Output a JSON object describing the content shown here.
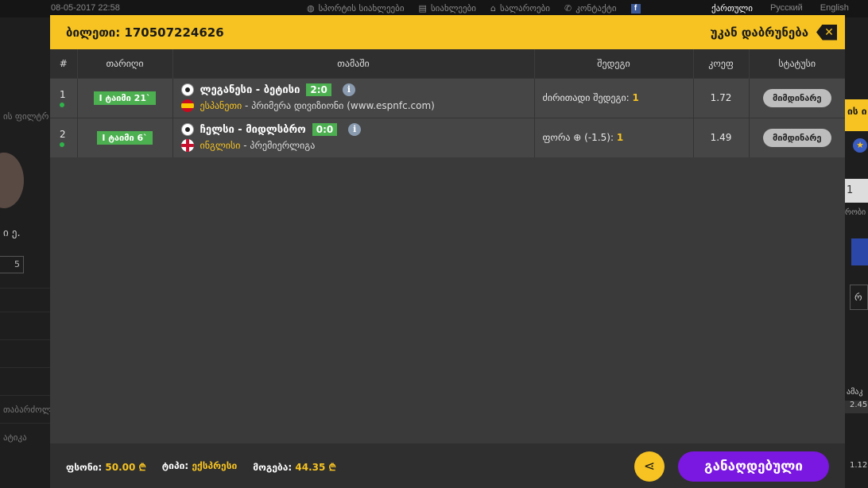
{
  "topbar": {
    "datetime": "08-05-2017 22:58",
    "nav": [
      {
        "label": "სპორტის სიახლეები",
        "icon": "globe-icon"
      },
      {
        "label": "სიახლეები",
        "icon": "newspaper-icon"
      },
      {
        "label": "სალაროები",
        "icon": "home-icon"
      },
      {
        "label": "კონტაქტი",
        "icon": "phone-icon"
      },
      {
        "label": "",
        "icon": "facebook-icon"
      }
    ],
    "languages": [
      "ქართული",
      "Русский",
      "English"
    ]
  },
  "background": {
    "left_rows": [
      "ის ფილტრ",
      "ი ე.",
      "5",
      "თაბარძოლ.",
      "ატიკა"
    ],
    "right_rows": [
      "ის ი",
      "1",
      "რობი",
      "რ",
      "ამაკ",
      "2.45",
      "1.12"
    ]
  },
  "modal": {
    "ticket_label": "ბილეთი: 170507224626",
    "back_label": "უკან დაბრუნება",
    "columns": [
      "#",
      "თარიღი",
      "თამაში",
      "შედეგი",
      "კოეფ",
      "სტატუსი"
    ],
    "rows": [
      {
        "num": "1",
        "period": "I ტაიმი 21`",
        "match": "ლეგანესი - ბეტისი",
        "score": "2:0",
        "country": "ესპანეთი",
        "league": " - პრიმერა დივიზიონი (www.espnfc.com)",
        "flag": "es",
        "result_label": "ძირითადი შედეგი: ",
        "result_value": "1",
        "coef": "1.72",
        "status": "მიმდინარე"
      },
      {
        "num": "2",
        "period": "I ტაიმი 6`",
        "match": "ჩელსი - მიდლსბრო",
        "score": "0:0",
        "country": "ინგლისი",
        "league": " - პრემიერლიგა",
        "flag": "en",
        "result_label": "ფორა ⊕ (-1.5): ",
        "result_value": "1",
        "coef": "1.49",
        "status": "მიმდინარე"
      }
    ],
    "footer": {
      "stake_label": "ფსონი: ",
      "stake_value": "50.00 ₾",
      "type_label": "ტიპი: ",
      "type_value": "ექსპრესი",
      "win_label": "მოგება: ",
      "win_value": "44.35 ₾",
      "share_icon": "share-icon",
      "cashout_label": "განაღდებული"
    }
  },
  "colors": {
    "accent": "#f6c322",
    "live_green": "#4caf50",
    "cashout_purple": "#7a17e0"
  }
}
